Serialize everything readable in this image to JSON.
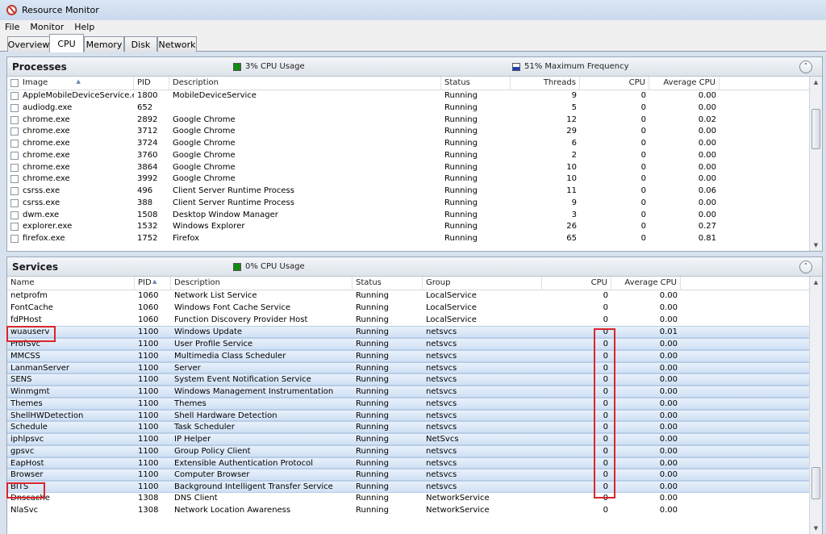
{
  "window": {
    "title": "Resource Monitor"
  },
  "menu": [
    "File",
    "Monitor",
    "Help"
  ],
  "tabs": [
    {
      "label": "Overview",
      "active": false
    },
    {
      "label": "CPU",
      "active": true
    },
    {
      "label": "Memory",
      "active": false
    },
    {
      "label": "Disk",
      "active": false
    },
    {
      "label": "Network",
      "active": false
    }
  ],
  "processes": {
    "title": "Processes",
    "cpu_usage": "3% CPU Usage",
    "max_freq": "51% Maximum Frequency",
    "columns": [
      "Image",
      "PID",
      "Description",
      "Status",
      "Threads",
      "CPU",
      "Average CPU"
    ],
    "rows": [
      [
        "AppleMobileDeviceService.exe",
        "1800",
        "MobileDeviceService",
        "Running",
        "9",
        "0",
        "0.00"
      ],
      [
        "audiodg.exe",
        "652",
        "",
        "Running",
        "5",
        "0",
        "0.00"
      ],
      [
        "chrome.exe",
        "2892",
        "Google Chrome",
        "Running",
        "12",
        "0",
        "0.02"
      ],
      [
        "chrome.exe",
        "3712",
        "Google Chrome",
        "Running",
        "29",
        "0",
        "0.00"
      ],
      [
        "chrome.exe",
        "3724",
        "Google Chrome",
        "Running",
        "6",
        "0",
        "0.00"
      ],
      [
        "chrome.exe",
        "3760",
        "Google Chrome",
        "Running",
        "2",
        "0",
        "0.00"
      ],
      [
        "chrome.exe",
        "3864",
        "Google Chrome",
        "Running",
        "10",
        "0",
        "0.00"
      ],
      [
        "chrome.exe",
        "3992",
        "Google Chrome",
        "Running",
        "10",
        "0",
        "0.00"
      ],
      [
        "csrss.exe",
        "496",
        "Client Server Runtime Process",
        "Running",
        "11",
        "0",
        "0.06"
      ],
      [
        "csrss.exe",
        "388",
        "Client Server Runtime Process",
        "Running",
        "9",
        "0",
        "0.00"
      ],
      [
        "dwm.exe",
        "1508",
        "Desktop Window Manager",
        "Running",
        "3",
        "0",
        "0.00"
      ],
      [
        "explorer.exe",
        "1532",
        "Windows Explorer",
        "Running",
        "26",
        "0",
        "0.27"
      ],
      [
        "firefox.exe",
        "1752",
        "Firefox",
        "Running",
        "65",
        "0",
        "0.81"
      ]
    ]
  },
  "services": {
    "title": "Services",
    "cpu_usage": "0% CPU Usage",
    "columns": [
      "Name",
      "PID",
      "Description",
      "Status",
      "Group",
      "CPU",
      "Average CPU"
    ],
    "rows": [
      [
        "netprofm",
        "1060",
        "Network List Service",
        "Running",
        "LocalService",
        "0",
        "0.00",
        false
      ],
      [
        "FontCache",
        "1060",
        "Windows Font Cache Service",
        "Running",
        "LocalService",
        "0",
        "0.00",
        false
      ],
      [
        "fdPHost",
        "1060",
        "Function Discovery Provider Host",
        "Running",
        "LocalService",
        "0",
        "0.00",
        false
      ],
      [
        "wuauserv",
        "1100",
        "Windows Update",
        "Running",
        "netsvcs",
        "0",
        "0.01",
        true
      ],
      [
        "ProfSvc",
        "1100",
        "User Profile Service",
        "Running",
        "netsvcs",
        "0",
        "0.00",
        true
      ],
      [
        "MMCSS",
        "1100",
        "Multimedia Class Scheduler",
        "Running",
        "netsvcs",
        "0",
        "0.00",
        true
      ],
      [
        "LanmanServer",
        "1100",
        "Server",
        "Running",
        "netsvcs",
        "0",
        "0.00",
        true
      ],
      [
        "SENS",
        "1100",
        "System Event Notification Service",
        "Running",
        "netsvcs",
        "0",
        "0.00",
        true
      ],
      [
        "Winmgmt",
        "1100",
        "Windows Management Instrumentation",
        "Running",
        "netsvcs",
        "0",
        "0.00",
        true
      ],
      [
        "Themes",
        "1100",
        "Themes",
        "Running",
        "netsvcs",
        "0",
        "0.00",
        true
      ],
      [
        "ShellHWDetection",
        "1100",
        "Shell Hardware Detection",
        "Running",
        "netsvcs",
        "0",
        "0.00",
        true
      ],
      [
        "Schedule",
        "1100",
        "Task Scheduler",
        "Running",
        "netsvcs",
        "0",
        "0.00",
        true
      ],
      [
        "iphlpsvc",
        "1100",
        "IP Helper",
        "Running",
        "NetSvcs",
        "0",
        "0.00",
        true
      ],
      [
        "gpsvc",
        "1100",
        "Group Policy Client",
        "Running",
        "netsvcs",
        "0",
        "0.00",
        true
      ],
      [
        "EapHost",
        "1100",
        "Extensible Authentication Protocol",
        "Running",
        "netsvcs",
        "0",
        "0.00",
        true
      ],
      [
        "Browser",
        "1100",
        "Computer Browser",
        "Running",
        "netsvcs",
        "0",
        "0.00",
        true
      ],
      [
        "BITS",
        "1100",
        "Background Intelligent Transfer Service",
        "Running",
        "netsvcs",
        "0",
        "0.00",
        true
      ],
      [
        "Dnscache",
        "1308",
        "DNS Client",
        "Running",
        "NetworkService",
        "0",
        "0.00",
        false
      ],
      [
        "NlaSvc",
        "1308",
        "Network Location Awareness",
        "Running",
        "NetworkService",
        "0",
        "0.00",
        false
      ]
    ]
  },
  "colors": {
    "annotation": "#d9262b",
    "selection": "#cfe0f4",
    "cpu_green": "#138a13",
    "freq_blue": "#1d3fb7"
  }
}
